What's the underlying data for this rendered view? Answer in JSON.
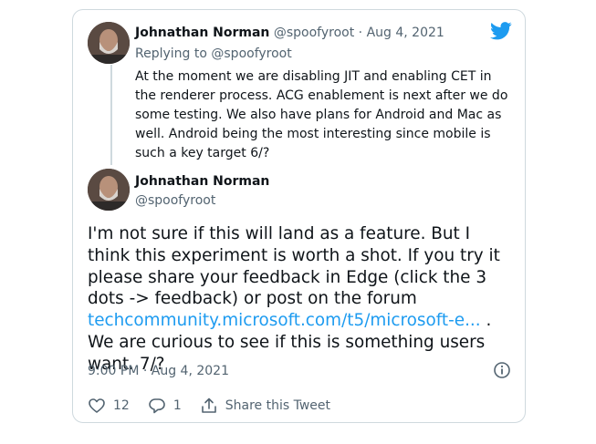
{
  "colors": {
    "brand": "#1d9bf0",
    "text": "#0f1419",
    "muted": "#536471",
    "border": "#cfd9de"
  },
  "icons": {
    "brand": "twitter-bird-icon",
    "info": "info-icon",
    "like": "heart-icon",
    "reply": "reply-icon",
    "share": "share-icon"
  },
  "reply_tweet": {
    "author_name": "Johnathan Norman",
    "handle": "@spoofyroot",
    "separator": "·",
    "date": "Aug 4, 2021",
    "replying_to_label": "Replying to",
    "replying_to_handle": "@spoofyroot",
    "text": "At the moment we are disabling JIT and enabling CET in the renderer process. ACG enablement is next after we do some testing. We also have plans for Android and Mac as well. Android being the most interesting since mobile is such a key target 6/?"
  },
  "main_tweet": {
    "author_name": "Johnathan Norman",
    "handle": "@spoofyroot",
    "text_before_link": "I'm not sure if this will land as a feature. But I think this experiment is worth a shot. If you try it please share your feedback in Edge (click the 3 dots -> feedback) or post on the forum",
    "link_text": "techcommunity.microsoft.com/t5/microsoft-e...",
    "text_after_link": ". We are curious to see if this is something users want. 7/?",
    "timestamp": "9:00 PM · Aug 4, 2021"
  },
  "actions": {
    "like_count": "12",
    "reply_count": "1",
    "share_label": "Share this Tweet"
  }
}
